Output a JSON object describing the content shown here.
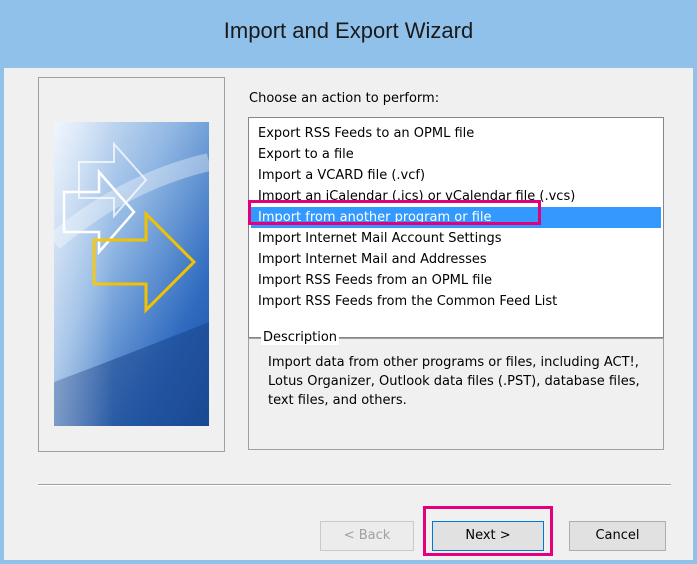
{
  "window": {
    "title": "Import and Export Wizard"
  },
  "prompt": "Choose an action to perform:",
  "actions": [
    "Export RSS Feeds to an OPML file",
    "Export to a file",
    "Import a VCARD file (.vcf)",
    "Import an iCalendar (.ics) or vCalendar file (.vcs)",
    "Import from another program or file",
    "Import Internet Mail Account Settings",
    "Import Internet Mail and Addresses",
    "Import RSS Feeds from an OPML file",
    "Import RSS Feeds from the Common Feed List"
  ],
  "selected_action_index": 4,
  "description": {
    "label": "Description",
    "text": "Import data from other programs or files, including ACT!, Lotus Organizer, Outlook data files (.PST), database files, text files, and others."
  },
  "buttons": {
    "back": "< Back",
    "next": "Next >",
    "cancel": "Cancel"
  },
  "colors": {
    "title_bar": "#8fc1ea",
    "selection": "#3399ff",
    "callout": "#e4007c"
  }
}
